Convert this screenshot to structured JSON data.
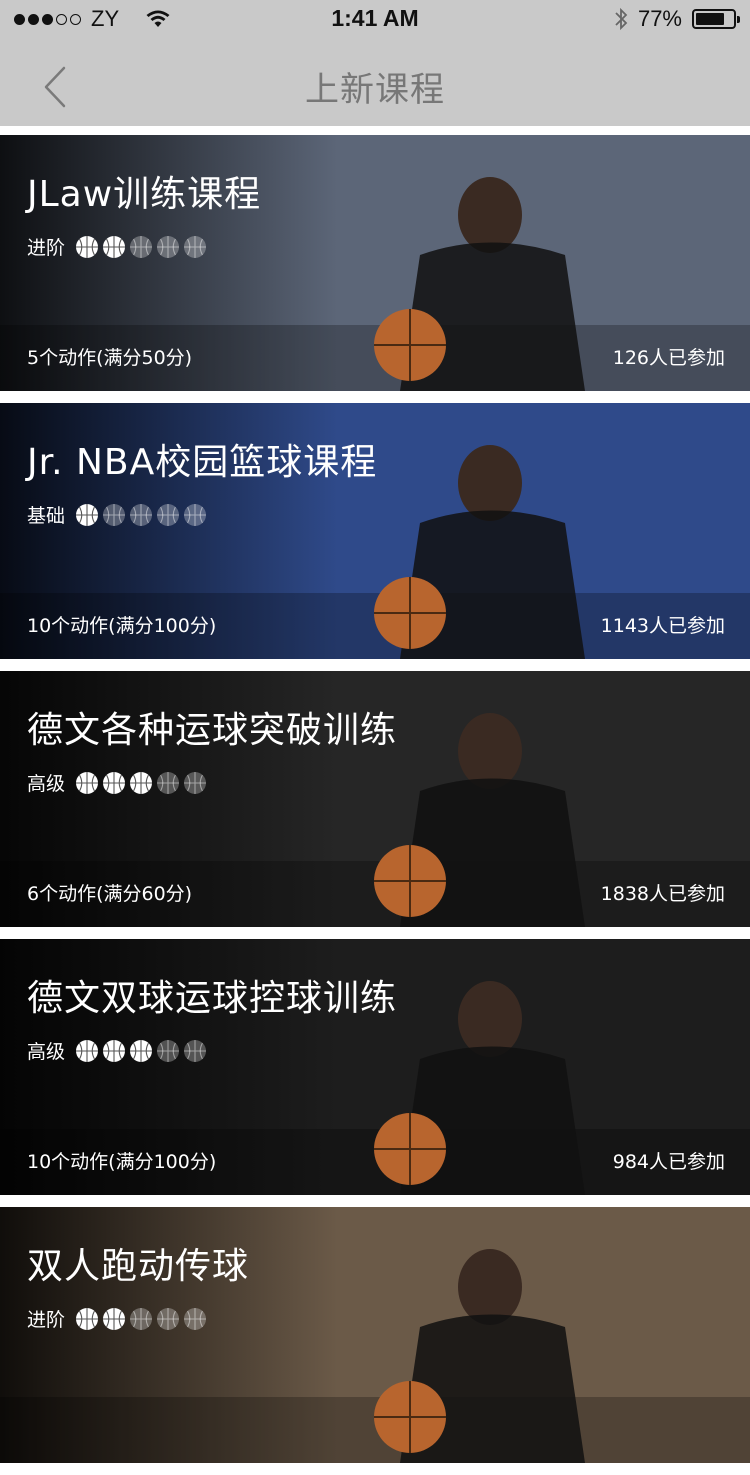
{
  "status_bar": {
    "carrier": "ZY",
    "time": "1:41 AM",
    "battery_percent": "77%",
    "battery_level": 0.77,
    "signal_strength": 3,
    "signal_total": 5
  },
  "nav": {
    "title": "上新课程",
    "back_icon": "chevron-left-icon"
  },
  "courses": [
    {
      "title": "JLaw训练课程",
      "level_label": "进阶",
      "level": 2,
      "max_level": 5,
      "actions": "5个动作(满分50分)",
      "participants": "126人已参加",
      "theme": "#5c6678"
    },
    {
      "title": "Jr. NBA校园篮球课程",
      "level_label": "基础",
      "level": 1,
      "max_level": 5,
      "actions": "10个动作(满分100分)",
      "participants": "1143人已参加",
      "theme": "#2f4a8a"
    },
    {
      "title": "德文各种运球突破训练",
      "level_label": "高级",
      "level": 3,
      "max_level": 5,
      "actions": "6个动作(满分60分)",
      "participants": "1838人已参加",
      "theme": "#262626"
    },
    {
      "title": "德文双球运球控球训练",
      "level_label": "高级",
      "level": 3,
      "max_level": 5,
      "actions": "10个动作(满分100分)",
      "participants": "984人已参加",
      "theme": "#1d1d1d"
    },
    {
      "title": "双人跑动传球",
      "level_label": "进阶",
      "level": 2,
      "max_level": 5,
      "actions": "",
      "participants": "",
      "theme": "#6b5a48"
    }
  ]
}
